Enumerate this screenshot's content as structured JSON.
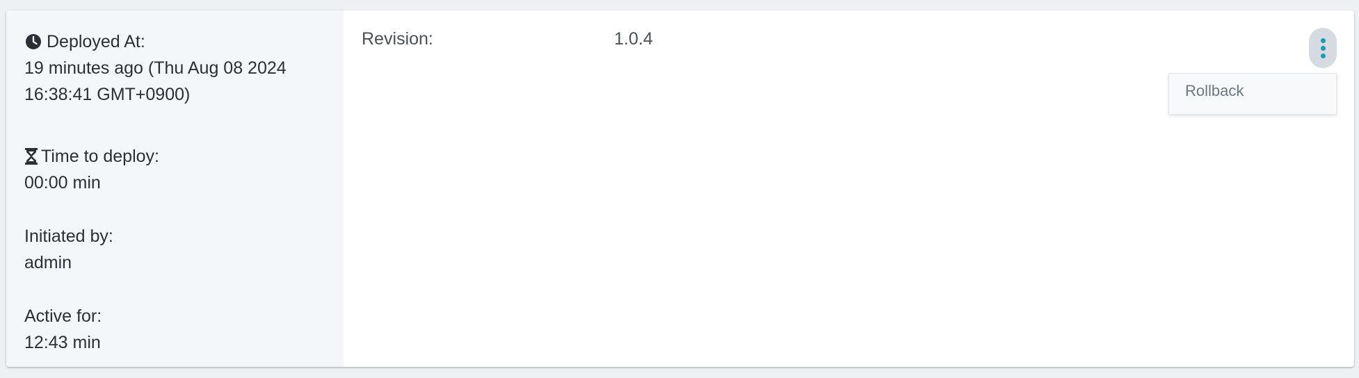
{
  "deployment": {
    "deployed_at_label": "Deployed At:",
    "deployed_at_line1": "19 minutes ago (Thu Aug 08 2024",
    "deployed_at_line2": "16:38:41 GMT+0900)",
    "time_to_deploy_label": "Time to deploy:",
    "time_to_deploy_value": "00:00 min",
    "initiated_by_label": "Initiated by:",
    "initiated_by_value": "admin",
    "active_for_label": "Active for:",
    "active_for_value": "12:43 min"
  },
  "revision": {
    "label": "Revision:",
    "value": "1.0.4"
  },
  "menu": {
    "items": [
      {
        "label": "Rollback"
      }
    ]
  },
  "icons": {
    "deployed_at": "clock-icon",
    "time_to_deploy": "hourglass-icon",
    "menu": "more-vertical-icon"
  },
  "colors": {
    "accent": "#1a9cb6",
    "left_panel_bg": "#f3f7fa",
    "kebab_bg": "#d5dbe0"
  }
}
